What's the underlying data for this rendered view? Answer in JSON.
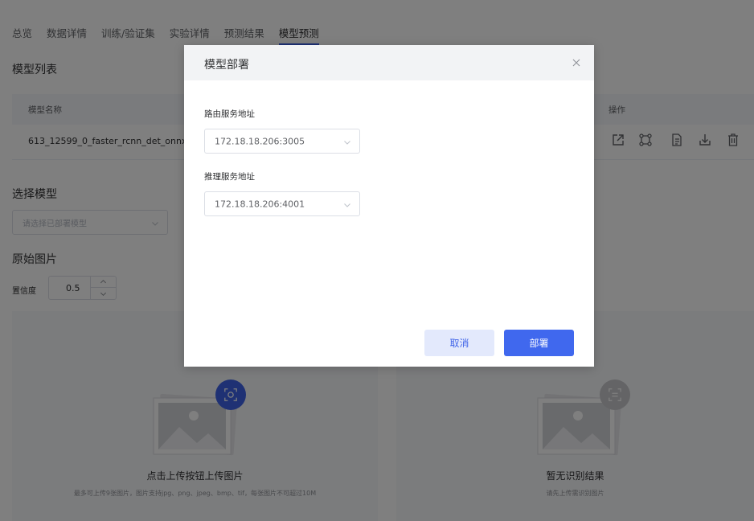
{
  "tabs": [
    "总览",
    "数据详情",
    "训练/验证集",
    "实验详情",
    "预测结果",
    "模型预测"
  ],
  "active_tab": "模型预测",
  "model_list": {
    "title": "模型列表",
    "columns": [
      "模型名称",
      "操作"
    ],
    "rows": [
      {
        "name": "613_12599_0_faster_rcnn_det_onnx"
      }
    ],
    "action_icons": [
      "deploy-icon",
      "model-structure-icon",
      "document-icon",
      "download-icon",
      "delete-icon"
    ]
  },
  "select_model": {
    "title": "选择模型",
    "placeholder": "请选择已部署模型"
  },
  "original_image": {
    "title": "原始图片",
    "confidence_label": "置信度",
    "confidence_value": "0.5"
  },
  "upload_panel": {
    "title": "点击上传按钮上传图片",
    "subtitle": "最多可上传9张图片，图片支持jpg、png、jpeg、bmp、tif，每张图片不可超过10M"
  },
  "result_panel": {
    "title": "暂无识别结果",
    "subtitle": "请先上传需识别图片"
  },
  "modal": {
    "title": "模型部署",
    "router_label": "路由服务地址",
    "router_value": "172.18.18.206:3005",
    "inference_label": "推理服务地址",
    "inference_value": "172.18.18.206:4001",
    "cancel_label": "取消",
    "deploy_label": "部署"
  },
  "colors": {
    "accent": "#4068ee",
    "cancel_bg": "#e3e9fc",
    "overlay": "rgba(0,0,0,0.5)"
  }
}
